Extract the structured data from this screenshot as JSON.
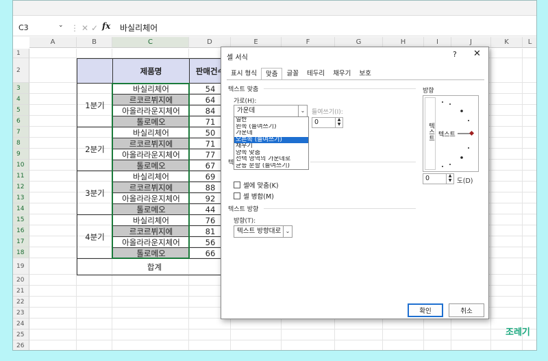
{
  "formula_bar": {
    "name_box": "C3",
    "content": "바실리체어"
  },
  "columns": [
    "A",
    "B",
    "C",
    "D",
    "E",
    "F",
    "G",
    "H",
    "I",
    "J",
    "K",
    "L"
  ],
  "rows": [
    "1",
    "2",
    "3",
    "4",
    "5",
    "6",
    "7",
    "8",
    "9",
    "10",
    "11",
    "12",
    "13",
    "14",
    "15",
    "16",
    "17",
    "18",
    "19",
    "20",
    "21",
    "22",
    "23",
    "24",
    "25",
    "26"
  ],
  "table": {
    "header": {
      "product": "제품명",
      "sales": "판매건수"
    },
    "quarters": [
      "1분기",
      "2분기",
      "3분기",
      "4분기"
    ],
    "items": [
      {
        "product": "바실리체어",
        "sales": "54"
      },
      {
        "product": "르코르뷔지에",
        "sales": "64"
      },
      {
        "product": "아올라라운지체어",
        "sales": "84"
      },
      {
        "product": "톨로메오",
        "sales": "71"
      },
      {
        "product": "바실리체어",
        "sales": "50"
      },
      {
        "product": "르코르뷔지에",
        "sales": "71"
      },
      {
        "product": "아올라라운지체어",
        "sales": "77"
      },
      {
        "product": "톨로메오",
        "sales": "67"
      },
      {
        "product": "바실리체어",
        "sales": "69"
      },
      {
        "product": "르코르뷔지에",
        "sales": "88"
      },
      {
        "product": "아올라라운지체어",
        "sales": "92"
      },
      {
        "product": "톨로메오",
        "sales": "44"
      },
      {
        "product": "바실리체어",
        "sales": "76"
      },
      {
        "product": "르코르뷔지에",
        "sales": "81"
      },
      {
        "product": "아올라라운지체어",
        "sales": "56"
      },
      {
        "product": "톨로메오",
        "sales": "66"
      }
    ],
    "total_label": "합계"
  },
  "dialog": {
    "title": "셀 서식",
    "help": "?",
    "close": "✕",
    "tabs": [
      "표시 형식",
      "맞춤",
      "글꼴",
      "테두리",
      "채우기",
      "보호"
    ],
    "text_align_section": "텍스트 맞춤",
    "horizontal_label": "가로(H):",
    "horizontal_value": "가운데",
    "indent_label": "들여쓰기(I):",
    "indent_value": "0",
    "horizontal_options": [
      "일반",
      "왼쪽 (들여쓰기)",
      "가운데",
      "오른쪽 (들여쓰기)",
      "채우기",
      "양쪽 맞춤",
      "선택 영역의 가운데로",
      "균등 분할 (들여쓰기)"
    ],
    "selected_option": "오른쪽 (들여쓰기)",
    "control_section_letter": "텍",
    "shrink_label": "셀에 맞춤(K)",
    "merge_label": "셀 병합(M)",
    "direction_section": "텍스트 방향",
    "direction_label": "방향(T):",
    "direction_value": "텍스트 방향대로",
    "orientation_title": "방향",
    "orientation_vertical": "텍스트",
    "orientation_horizontal": "텍스트",
    "degrees_value": "0",
    "degrees_label": "도(D)",
    "ok": "확인",
    "cancel": "취소"
  },
  "watermark": "조레기"
}
